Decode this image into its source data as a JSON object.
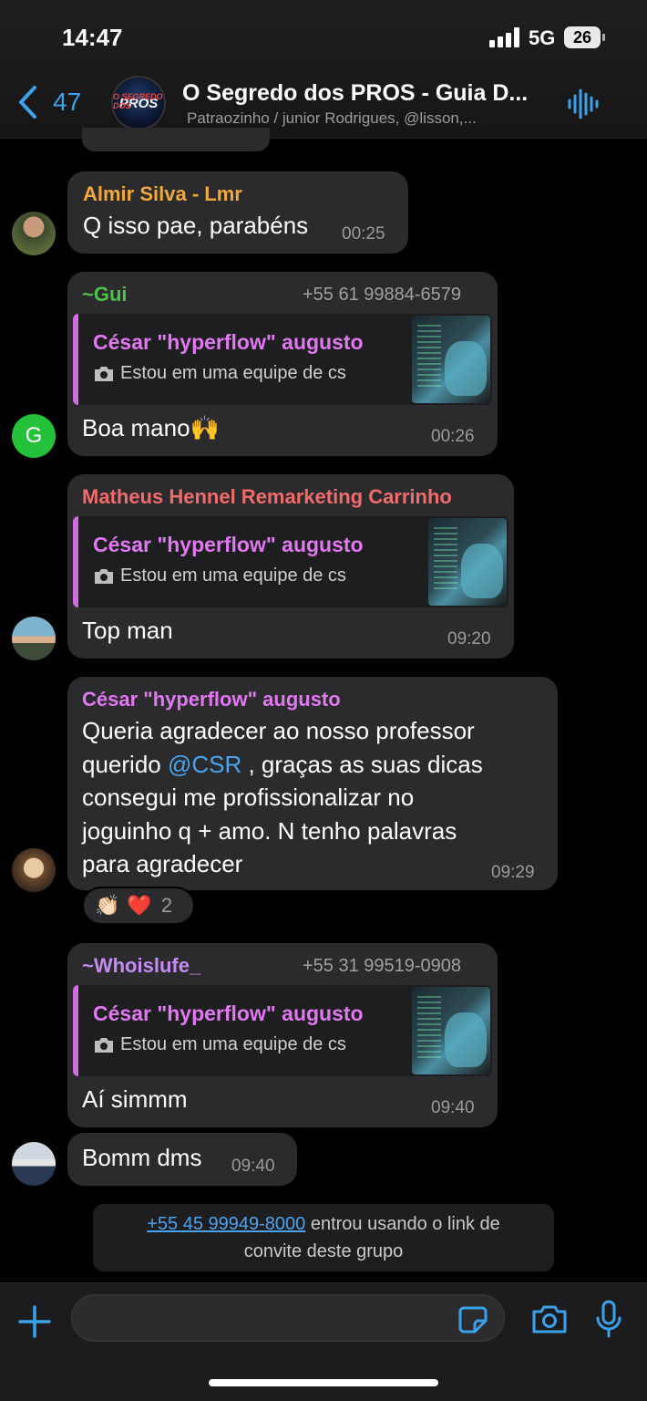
{
  "status": {
    "time": "14:47",
    "network": "5G",
    "battery": "26"
  },
  "header": {
    "back_count": "47",
    "avatar_text": "PROS",
    "title": "O Segredo dos PROS - Guia D...",
    "subtitle": "Patraozinho / junior Rodrigues, @lisson,..."
  },
  "messages": [
    {
      "sender": "Almir Silva - Lmr",
      "text": "Q isso pae, parabéns",
      "time": "00:25",
      "sender_color": "#f2a93b"
    },
    {
      "sender": "~Gui",
      "phone": "+55 61 99884-6579",
      "quote_sender": "César \"hyperflow\" augusto",
      "quote_text": "Estou em uma equipe de cs",
      "text": "Boa mano🙌",
      "time": "00:26",
      "sender_color": "#4cc24a",
      "avatar_letter": "G"
    },
    {
      "sender": "Matheus Hennel Remarketing Carrinho",
      "quote_sender": "César \"hyperflow\" augusto",
      "quote_text": "Estou em uma equipe de cs",
      "text": "Top man",
      "time": "09:20",
      "sender_color": "#f06c6c"
    },
    {
      "sender": "César \"hyperflow\" augusto",
      "line1": "Queria agradecer ao nosso professor",
      "line2_pre": "querido ",
      "mention": "@CSR",
      "line2_post": " , graças as suas dicas",
      "line3": "consegui me profissionalizar no",
      "line4": "joguinho q + amo. N tenho palavras",
      "line5": "para agradecer",
      "time": "09:29",
      "sender_color": "#e078f0",
      "reactions": {
        "emoji1": "👏🏻",
        "emoji2": "❤️",
        "count": "2"
      }
    },
    {
      "sender": "~Whoislufe_",
      "phone": "+55 31 99519-0908",
      "quote_sender": "César \"hyperflow\" augusto",
      "quote_text": "Estou em uma equipe de cs",
      "text": "Aí simmm",
      "time": "09:40",
      "sender_color": "#c58cf0"
    },
    {
      "text": "Bomm dms",
      "time": "09:40"
    }
  ],
  "system_message": {
    "phone": "+55 45 99949-8000",
    "text1": " entrou usando o link de",
    "text2": "convite deste grupo"
  },
  "colors": {
    "accent": "#3aa2ea",
    "bubble": "#2b2b2d",
    "mention": "#4aa3f0"
  }
}
